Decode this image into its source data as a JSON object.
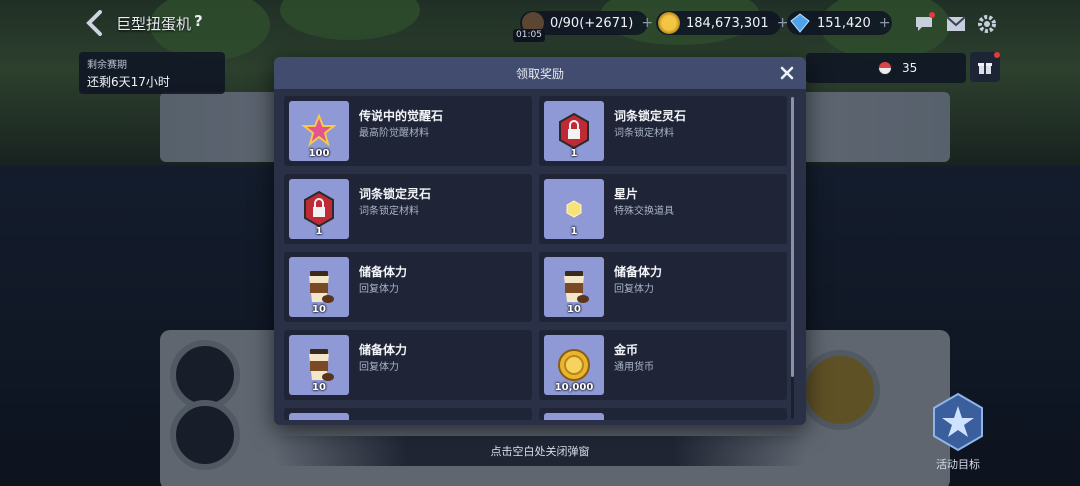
{
  "hud": {
    "title": "巨型扭蛋机",
    "help": "?",
    "stamina": {
      "value": "0/90(+2671)",
      "icon": "coffee-cup-icon"
    },
    "timer": "01:05",
    "gold": {
      "value": "184,673,301",
      "icon": "gold-coin-icon"
    },
    "diamond": {
      "value": "151,420",
      "icon": "diamond-icon"
    },
    "icons": [
      "chat-icon",
      "mail-icon",
      "gear-icon"
    ]
  },
  "season": {
    "label": "剩余赛期",
    "remaining": "还剩6天17小时"
  },
  "capsule_count": "35",
  "activity_goal": "活动目标",
  "modal": {
    "title": "领取奖励",
    "close_icon": "close-icon",
    "rewards": [
      {
        "name": "传说中的觉醒石",
        "desc": "最高阶觉醒材料",
        "qty": "100",
        "icon": "awakening-stone-icon"
      },
      {
        "name": "词条锁定灵石",
        "desc": "词条锁定材料",
        "qty": "1",
        "icon": "lock-stone-icon"
      },
      {
        "name": "词条锁定灵石",
        "desc": "词条锁定材料",
        "qty": "1",
        "icon": "lock-stone-icon"
      },
      {
        "name": "星片",
        "desc": "特殊交换道具",
        "qty": "1",
        "icon": "star-shard-icon"
      },
      {
        "name": "储备体力",
        "desc": "回复体力",
        "qty": "10",
        "icon": "coffee-cup-icon"
      },
      {
        "name": "储备体力",
        "desc": "回复体力",
        "qty": "10",
        "icon": "coffee-cup-icon"
      },
      {
        "name": "储备体力",
        "desc": "回复体力",
        "qty": "10",
        "icon": "coffee-cup-icon"
      },
      {
        "name": "金币",
        "desc": "通用货币",
        "qty": "10,000",
        "icon": "gold-coin-icon"
      }
    ]
  },
  "hint": "点击空白处关闭弹窗",
  "colors": {
    "modal_bg": "#2a3146",
    "modal_header": "#424c6e",
    "card_bg": "#1f2537",
    "thumb_bg": "#8e99d6"
  }
}
